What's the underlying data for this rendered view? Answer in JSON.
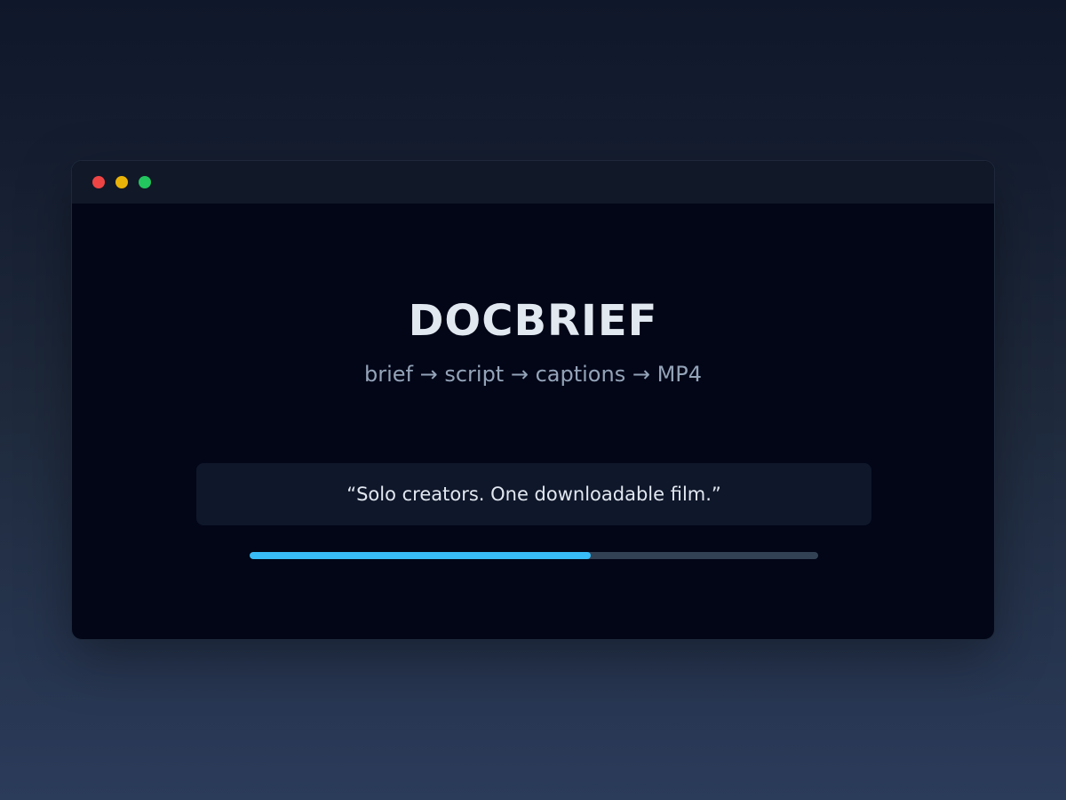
{
  "window": {
    "controls": {
      "close_color": "#ef4444",
      "minimize_color": "#eab308",
      "maximize_color": "#22c55e"
    }
  },
  "app": {
    "title": "DOCBRIEF",
    "subtitle": "brief → script → captions → MP4"
  },
  "quote": {
    "text": "“Solo creators. One downloadable film.”"
  },
  "progress": {
    "value": 0.6,
    "color": "#38bdf8",
    "track_color": "#334155"
  }
}
